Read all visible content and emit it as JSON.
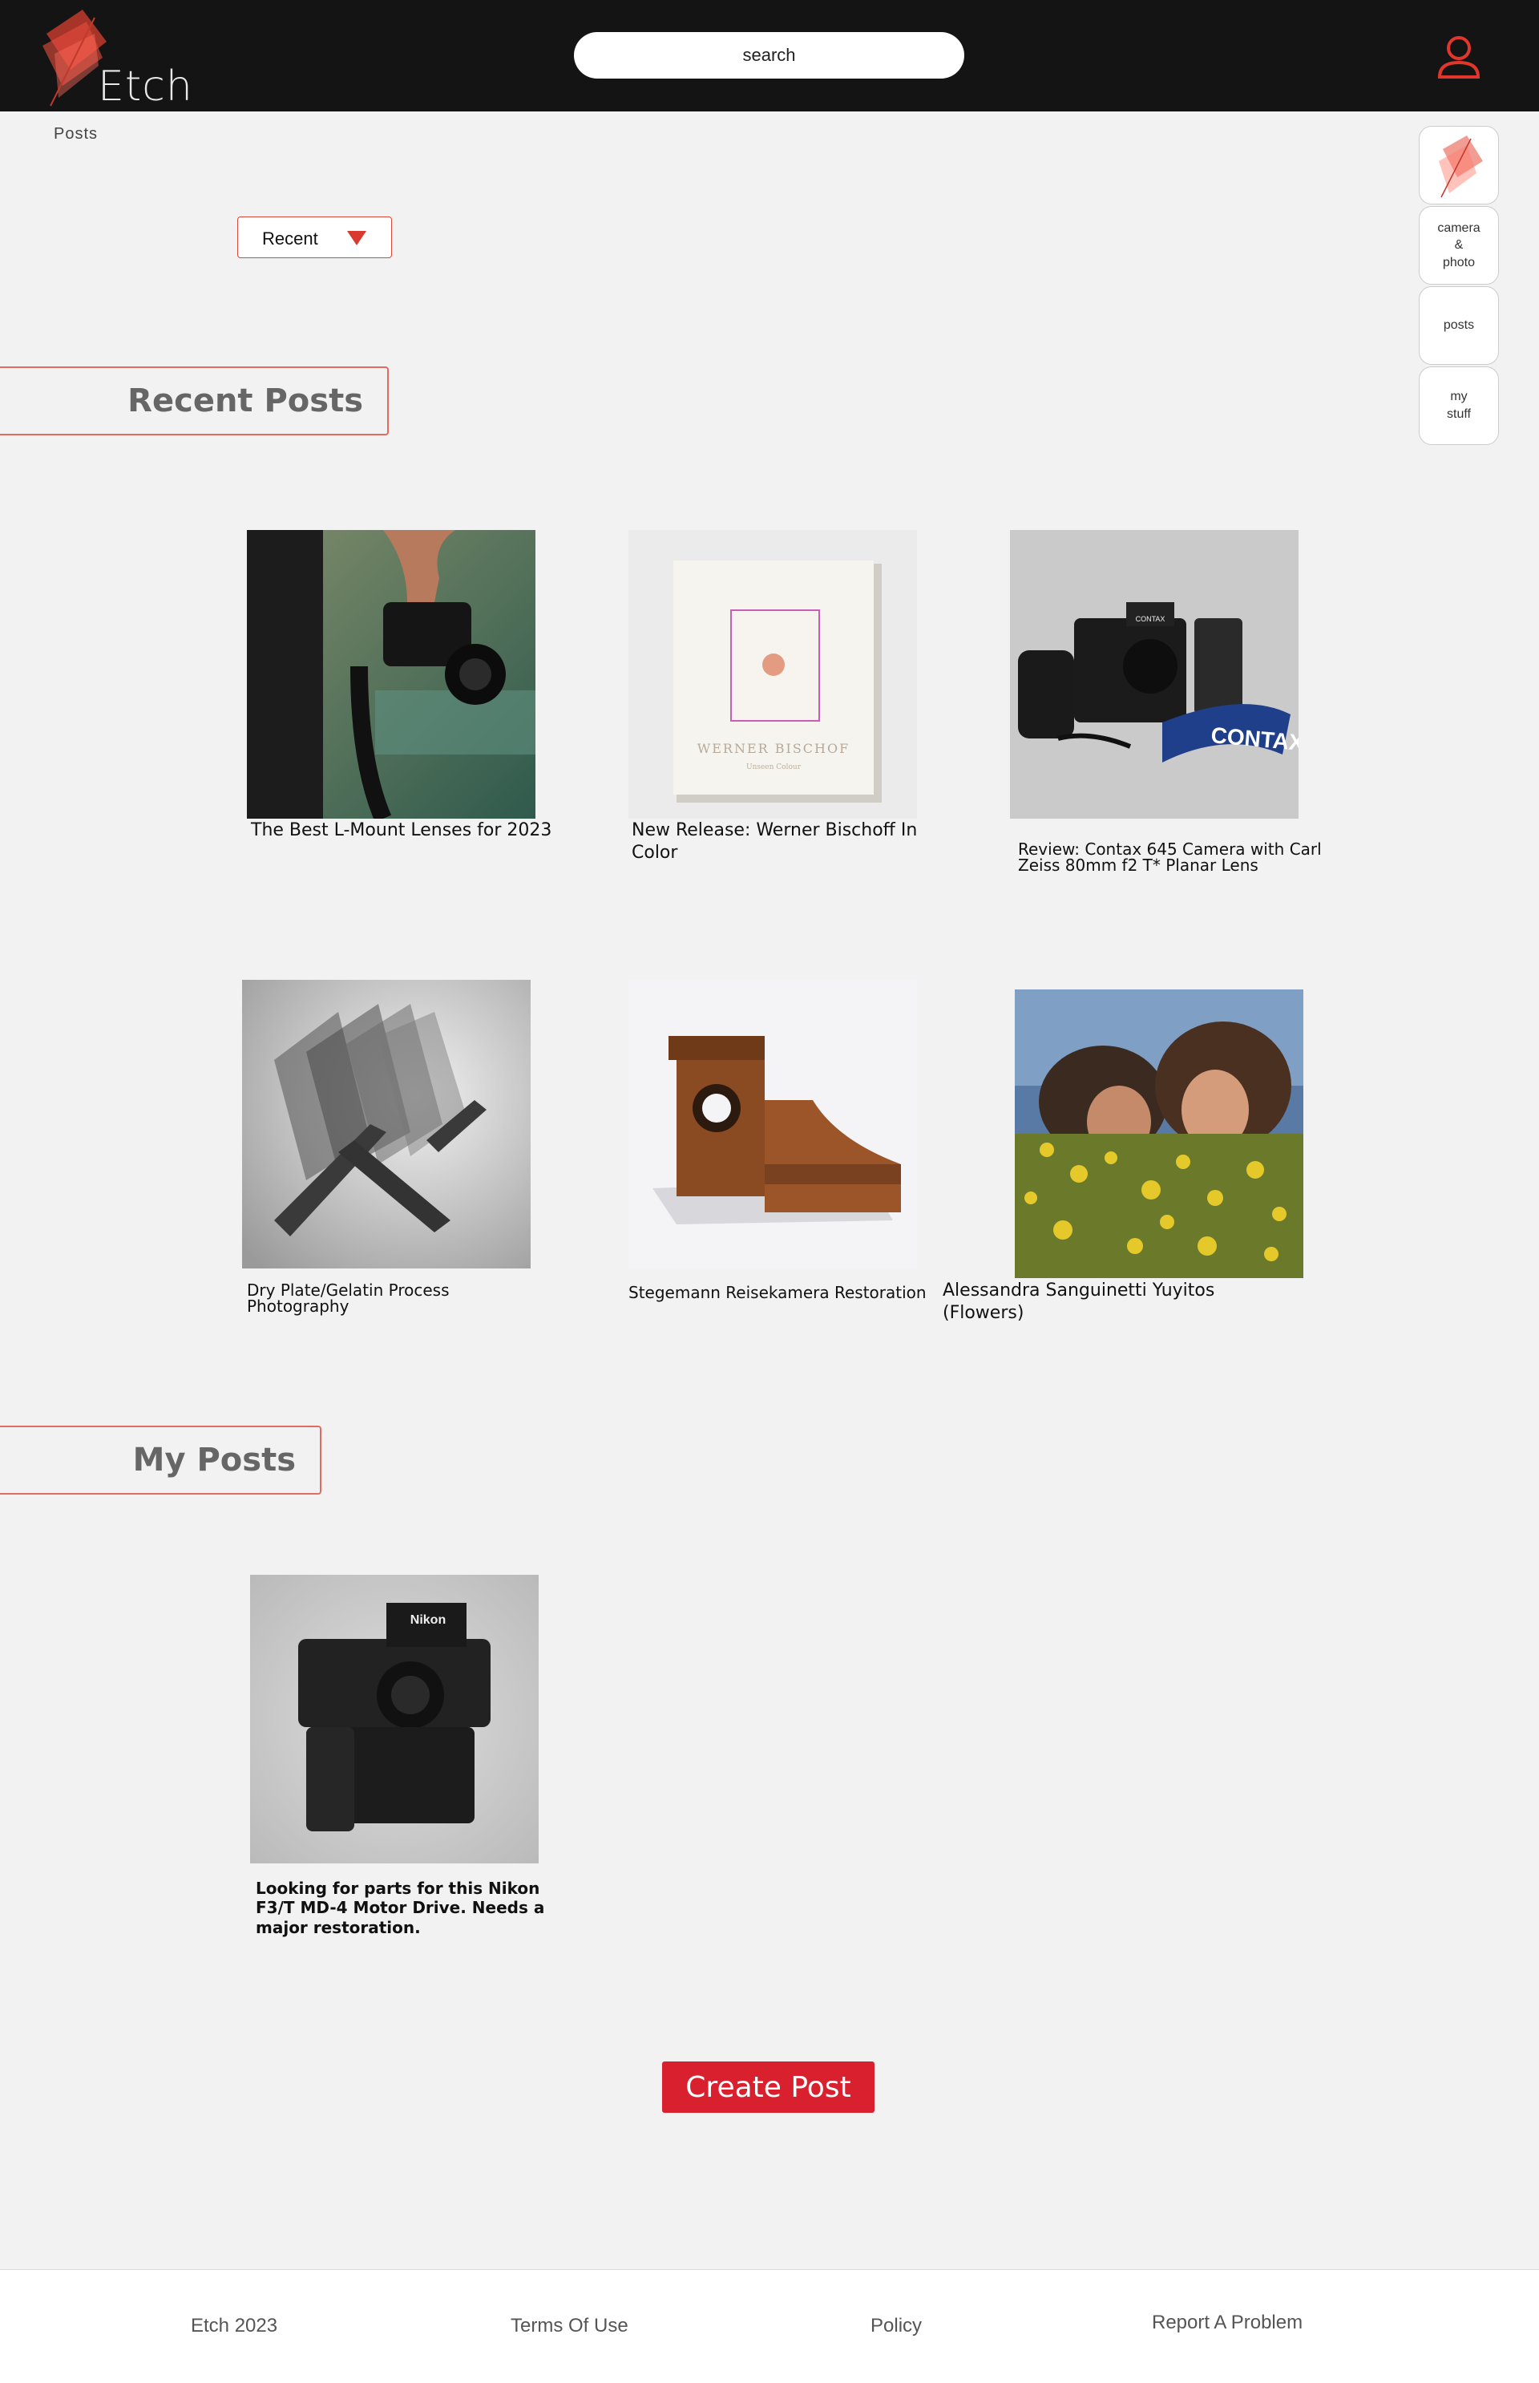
{
  "header": {
    "logo_text": "Etch",
    "search_placeholder": "search",
    "user_icon": "user-icon"
  },
  "breadcrumb": "Posts",
  "sort": {
    "selected": "Recent"
  },
  "sidenav": {
    "items": [
      {
        "label": "",
        "icon": "etch-logo-icon"
      },
      {
        "label": "camera\n&\nphoto"
      },
      {
        "label": "posts"
      },
      {
        "label": "my\nstuff"
      }
    ]
  },
  "sections": {
    "recent_title": "Recent Posts",
    "mine_title": "My Posts"
  },
  "recent_posts": [
    {
      "caption": "The Best L-Mount Lenses for 2023",
      "image": "hand-holding-camera"
    },
    {
      "caption": "New Release: Werner Bischoff In Color",
      "image": "book-cover"
    },
    {
      "caption": "Review: Contax 645 Camera with Carl Zeiss 80mm f2 T* Planar Lens",
      "image": "contax-camera-kit"
    },
    {
      "caption": "Dry Plate/Gelatin Process Photography",
      "image": "glass-plate-rack"
    },
    {
      "caption": "Stegemann Reisekamera Restoration",
      "image": "wooden-camera"
    },
    {
      "caption": "Alessandra Sanguinetti Yuyitos (Flowers)",
      "image": "girls-in-flowers"
    }
  ],
  "book_text": "WERNER BISCHOF",
  "book_subtitle": "Unseen Colour",
  "contax_strap": "CONTAX",
  "contax_label": "CONTAX",
  "my_posts": [
    {
      "caption": "Looking for parts for this Nikon F3/T MD-4 Motor Drive. Needs a major restoration.",
      "image": "nikon-f3"
    }
  ],
  "nikon_label": "Nikon",
  "create_button": "Create Post",
  "footer": {
    "copyright": "Etch 2023",
    "terms": "Terms Of Use",
    "policy": "Policy",
    "report": "Report A Problem"
  },
  "colors": {
    "accent": "#d9202e",
    "header_bg": "#141414",
    "page_bg": "#f2f2f2"
  }
}
